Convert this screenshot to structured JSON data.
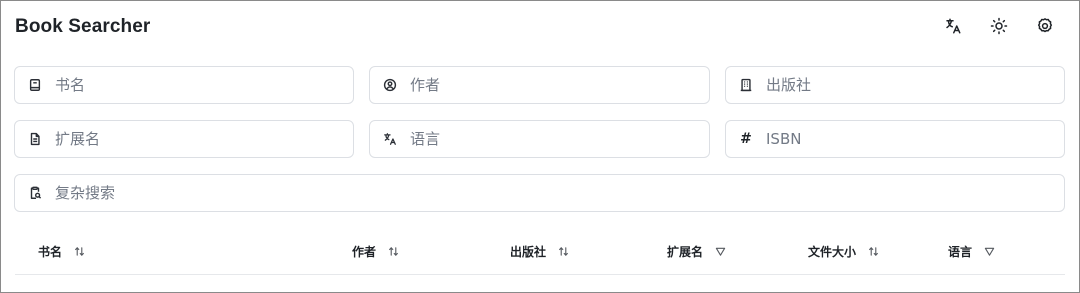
{
  "app": {
    "title": "Book Searcher"
  },
  "header": {
    "actions": [
      {
        "name": "translate-icon"
      },
      {
        "name": "sun-icon"
      },
      {
        "name": "gear-icon"
      }
    ]
  },
  "search": {
    "title_placeholder": "书名",
    "author_placeholder": "作者",
    "publisher_placeholder": "出版社",
    "extension_placeholder": "扩展名",
    "language_placeholder": "语言",
    "isbn_placeholder": "ISBN",
    "complex_placeholder": "复杂搜索",
    "isbn_icon_glyph": "#"
  },
  "table": {
    "columns": [
      {
        "label": "书名",
        "control": "sort"
      },
      {
        "label": "作者",
        "control": "sort"
      },
      {
        "label": "出版社",
        "control": "sort"
      },
      {
        "label": "扩展名",
        "control": "filter"
      },
      {
        "label": "文件大小",
        "control": "sort"
      },
      {
        "label": "语言",
        "control": "filter"
      }
    ]
  }
}
